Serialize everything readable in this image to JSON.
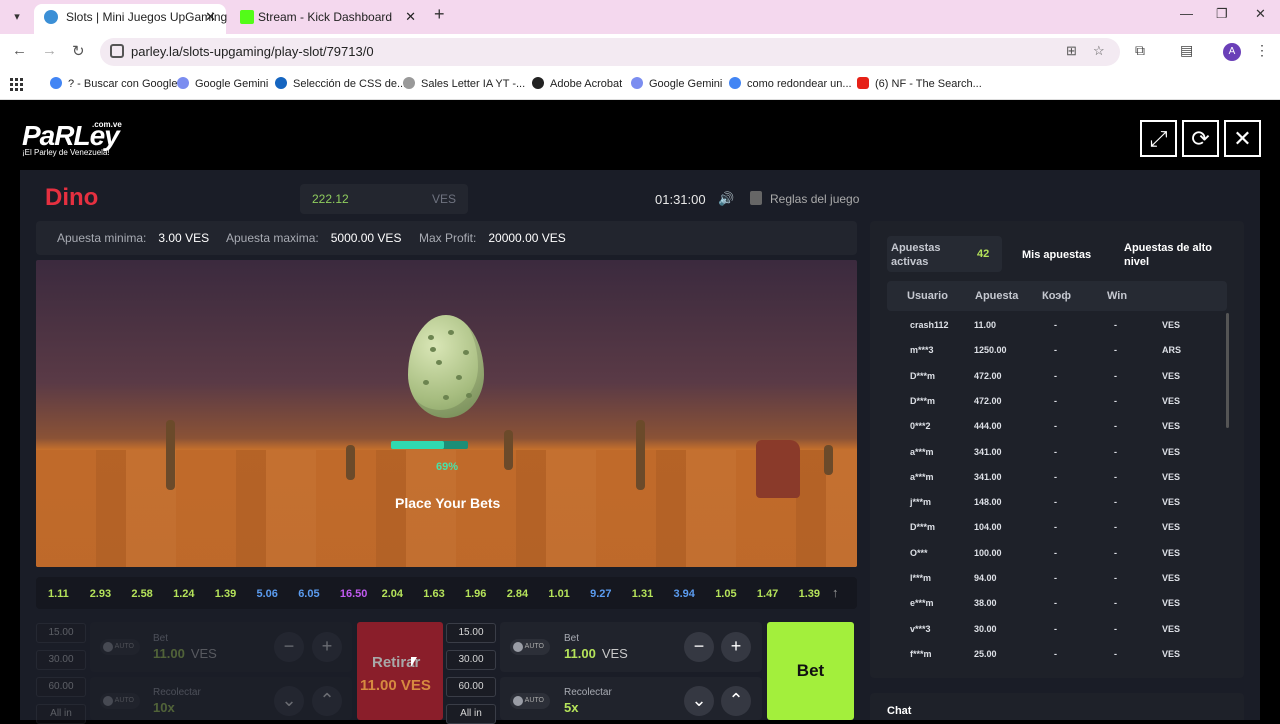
{
  "browser": {
    "tabs": [
      {
        "title": "Slots | Mini Juegos UpGaming",
        "active": true
      },
      {
        "title": "Stream - Kick Dashboard",
        "active": false
      }
    ],
    "new_tab": "+",
    "url": "parley.la/slots-upgaming/play-slot/79713/0",
    "avatar": "A",
    "bookmarks": [
      {
        "label": "? - Buscar con Google",
        "icon": "google-icon"
      },
      {
        "label": "Google Gemini",
        "icon": "gemini-icon"
      },
      {
        "label": "Selección de CSS de...",
        "icon": "css-icon"
      },
      {
        "label": "Sales Letter IA YT -...",
        "icon": "sales-icon"
      },
      {
        "label": "Adobe Acrobat",
        "icon": "acrobat-icon"
      },
      {
        "label": "Google Gemini",
        "icon": "gemini-icon"
      },
      {
        "label": "como redondear un...",
        "icon": "google-icon"
      },
      {
        "label": "(6) NF - The Search...",
        "icon": "youtube-icon"
      }
    ]
  },
  "site": {
    "logo": "PaRLey",
    "logo_domain": ".com.ve",
    "tagline": "¡El Parley de Venezuela!"
  },
  "game": {
    "title": "Dino",
    "balance": "222.12",
    "currency": "VES",
    "timer": "01:31:00",
    "rules_label": "Reglas del juego",
    "limits": {
      "min_label": "Apuesta minima:",
      "min_value": "3.00 VES",
      "max_label": "Apuesta maxima:",
      "max_value": "5000.00 VES",
      "profit_label": "Max Profit:",
      "profit_value": "20000.00 VES"
    },
    "progress_percent": 69,
    "progress_label": "69%",
    "status": "Place Your Bets",
    "history": [
      {
        "v": "1.11",
        "c": "#b5e35a"
      },
      {
        "v": "2.93",
        "c": "#b5e35a"
      },
      {
        "v": "2.58",
        "c": "#b5e35a"
      },
      {
        "v": "1.24",
        "c": "#b5e35a"
      },
      {
        "v": "1.39",
        "c": "#b5e35a"
      },
      {
        "v": "5.06",
        "c": "#5b9cf0"
      },
      {
        "v": "6.05",
        "c": "#5b9cf0"
      },
      {
        "v": "16.50",
        "c": "#c15af0"
      },
      {
        "v": "2.04",
        "c": "#b5e35a"
      },
      {
        "v": "1.63",
        "c": "#b5e35a"
      },
      {
        "v": "1.96",
        "c": "#b5e35a"
      },
      {
        "v": "2.84",
        "c": "#b5e35a"
      },
      {
        "v": "1.01",
        "c": "#b5e35a"
      },
      {
        "v": "9.27",
        "c": "#5b9cf0"
      },
      {
        "v": "1.31",
        "c": "#b5e35a"
      },
      {
        "v": "3.94",
        "c": "#5b9cf0"
      },
      {
        "v": "1.05",
        "c": "#b5e35a"
      },
      {
        "v": "1.47",
        "c": "#b5e35a"
      },
      {
        "v": "1.39",
        "c": "#b5e35a"
      }
    ],
    "quick_amounts": [
      "15.00",
      "30.00",
      "60.00",
      "All in"
    ],
    "auto_label": "AUTO",
    "bet_label": "Bet",
    "bet_value": "11.00",
    "collect_label": "Recolectar",
    "collect_value": "10x",
    "collect_value_right": "5x",
    "retirar_label": "Retirar",
    "retirar_amount": "11.00 VES",
    "bet_button": "Bet"
  },
  "sidebar": {
    "tab_active_line1": "Apuestas",
    "tab_active_line2": "activas",
    "active_count": "42",
    "tab_mine": "Mis apuestas",
    "tab_high_line1": "Apuestas de alto",
    "tab_high_line2": "nivel",
    "columns": [
      "Usuario",
      "Apuesta",
      "Коэф",
      "Win"
    ],
    "rows": [
      [
        "crash112",
        "11.00",
        "-",
        "-",
        "VES"
      ],
      [
        "m***3",
        "1250.00",
        "-",
        "-",
        "ARS"
      ],
      [
        "D***m",
        "472.00",
        "-",
        "-",
        "VES"
      ],
      [
        "D***m",
        "472.00",
        "-",
        "-",
        "VES"
      ],
      [
        "0***2",
        "444.00",
        "-",
        "-",
        "VES"
      ],
      [
        "a***m",
        "341.00",
        "-",
        "-",
        "VES"
      ],
      [
        "a***m",
        "341.00",
        "-",
        "-",
        "VES"
      ],
      [
        "j***m",
        "148.00",
        "-",
        "-",
        "VES"
      ],
      [
        "D***m",
        "104.00",
        "-",
        "-",
        "VES"
      ],
      [
        "O***",
        "100.00",
        "-",
        "-",
        "VES"
      ],
      [
        "l***m",
        "94.00",
        "-",
        "-",
        "VES"
      ],
      [
        "e***m",
        "38.00",
        "-",
        "-",
        "VES"
      ],
      [
        "v***3",
        "30.00",
        "-",
        "-",
        "VES"
      ],
      [
        "f***m",
        "25.00",
        "-",
        "-",
        "VES"
      ]
    ],
    "chat_label": "Chat"
  }
}
